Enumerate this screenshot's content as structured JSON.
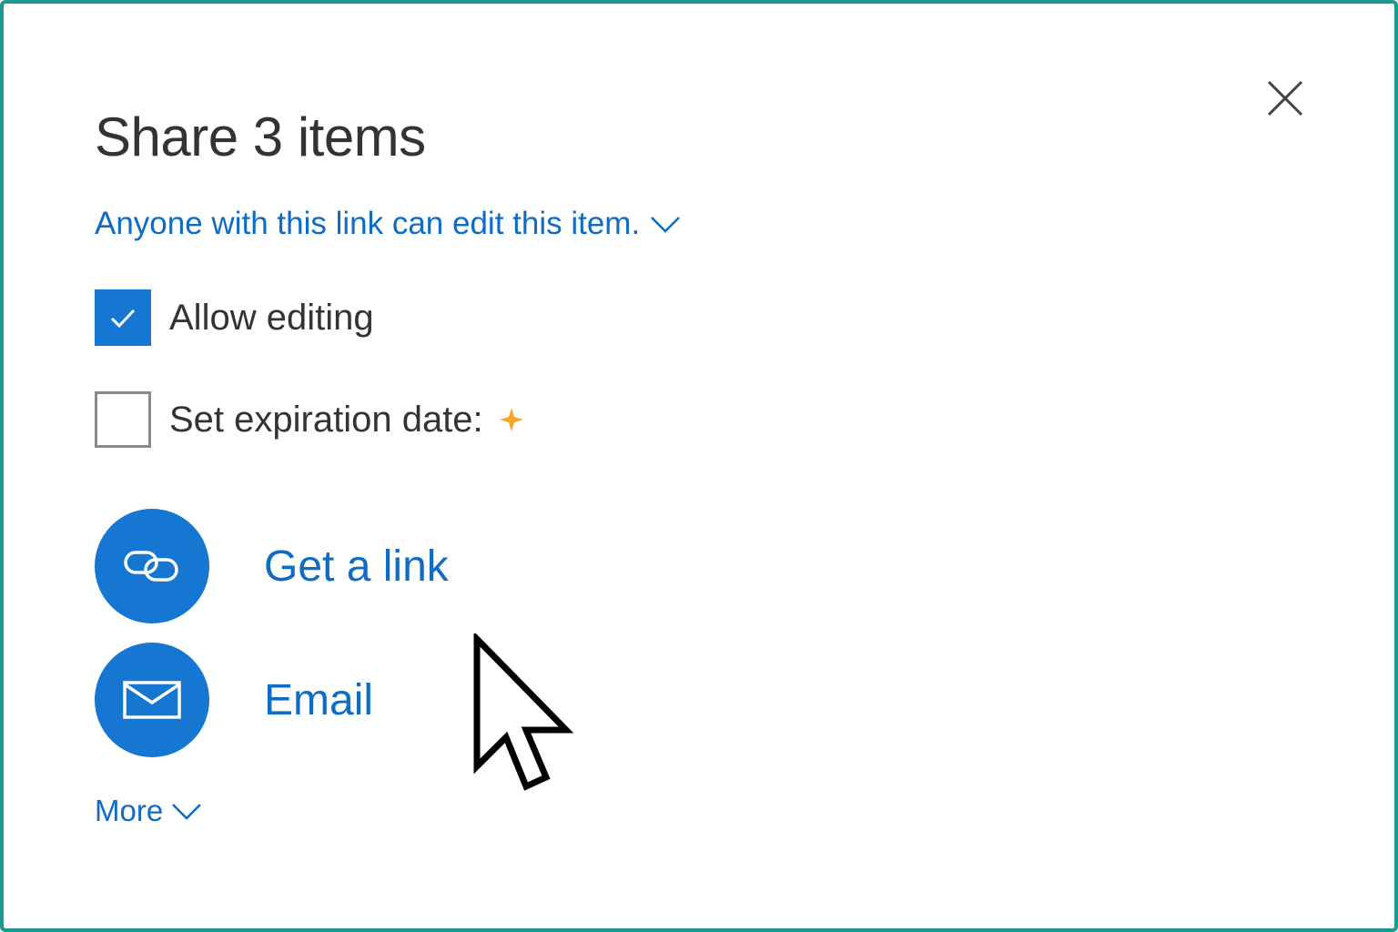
{
  "dialog": {
    "title": "Share 3 items",
    "permission_text": "Anyone with this link can edit this item.",
    "options": {
      "allow_editing": {
        "label": "Allow editing",
        "checked": true
      },
      "expiration": {
        "label": "Set expiration date:",
        "checked": false,
        "badge_icon": "premium-sparkle-icon"
      }
    },
    "actions": {
      "get_link": {
        "label": "Get a link",
        "icon": "link-icon"
      },
      "email": {
        "label": "Email",
        "icon": "envelope-icon"
      }
    },
    "more_label": "More",
    "close_icon": "close-icon"
  },
  "colors": {
    "accent": "#1577d1",
    "link_text": "#0f6cc4",
    "frame_border": "#1a9a8f",
    "premium_badge": "#f7a623"
  }
}
